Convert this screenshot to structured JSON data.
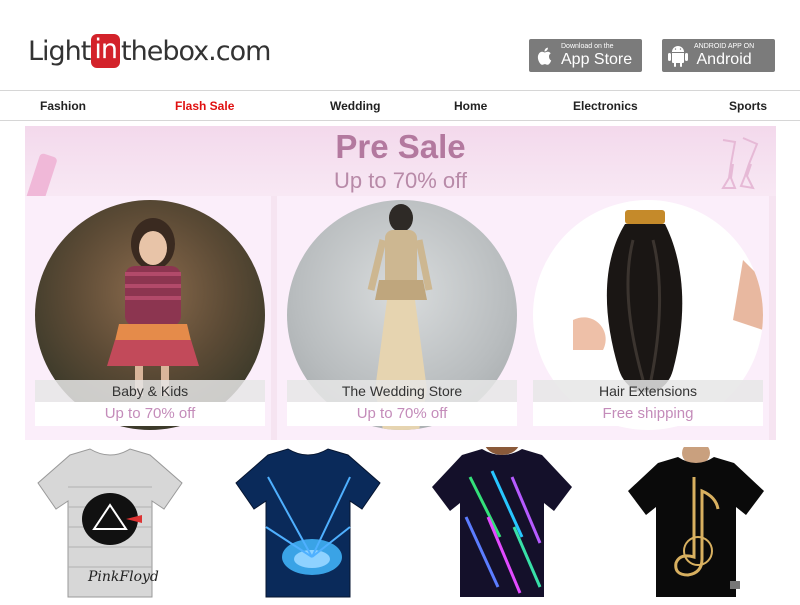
{
  "logo": {
    "pre": "Light",
    "mid": "in",
    "post": "thebox",
    "suffix": ".com"
  },
  "app_store": {
    "small": "Download on the",
    "big": "App Store"
  },
  "android": {
    "small": "ANDROID APP ON",
    "big": "Android"
  },
  "nav": [
    {
      "label": "Fashion"
    },
    {
      "label": "Flash Sale"
    },
    {
      "label": "Wedding"
    },
    {
      "label": "Home"
    },
    {
      "label": "Electronics"
    },
    {
      "label": "Sports"
    }
  ],
  "banner": {
    "title": "Pre Sale",
    "subtitle": "Up to 70% off",
    "panels": [
      {
        "caption": "Baby & Kids",
        "offer": "Up to 70% off"
      },
      {
        "caption": "The Wedding Store",
        "offer": "Up to 70% off"
      },
      {
        "caption": "Hair Extensions",
        "offer": "Free shipping"
      }
    ]
  },
  "colors": {
    "flash_sale": "#e01010",
    "banner_bg": "#f6e4f1",
    "title": "#b3799f",
    "logo_red": "#d3222a"
  }
}
